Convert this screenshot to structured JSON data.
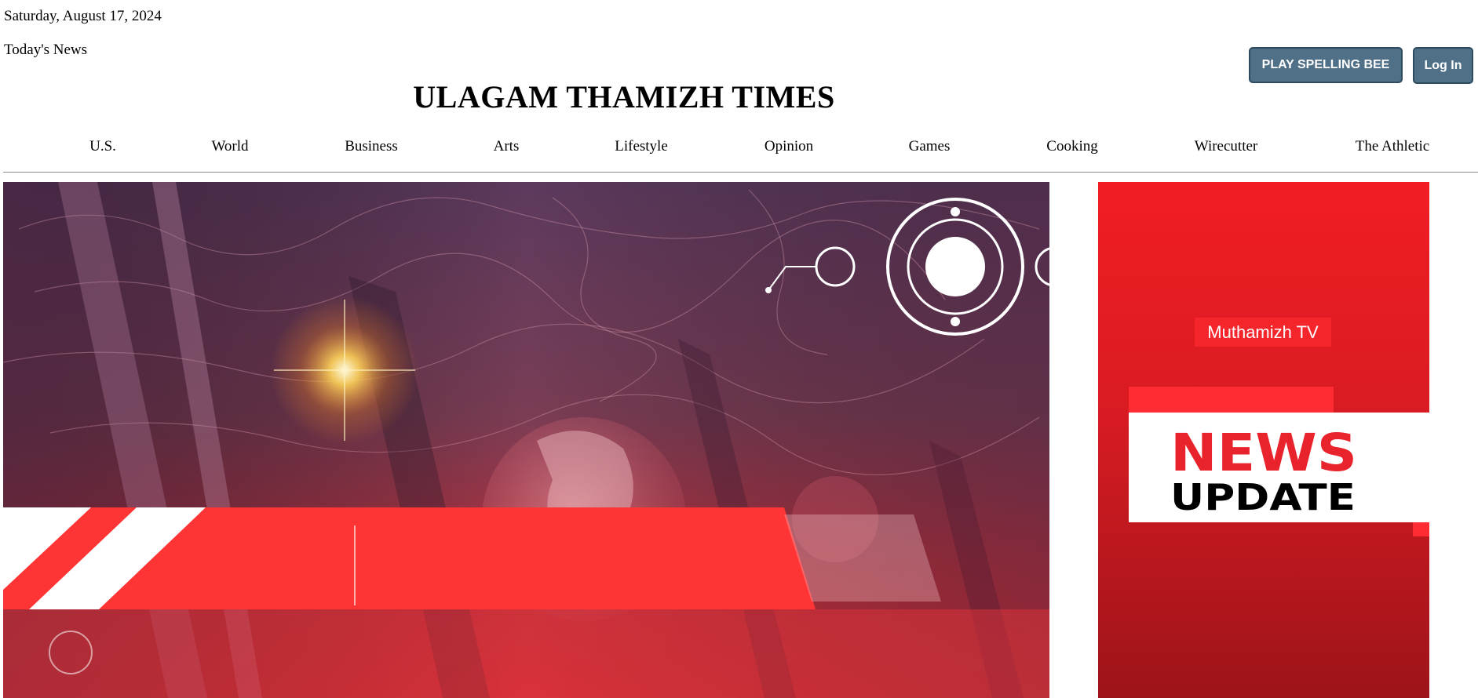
{
  "header": {
    "date": "Saturday, August 17, 2024",
    "todays_news": "Today's News",
    "title": "ULAGAM THAMIZH TIMES",
    "buttons": {
      "spelling_bee": "PLAY SPELLING BEE",
      "login": "Log In"
    }
  },
  "nav": {
    "items": [
      {
        "label": "U.S."
      },
      {
        "label": "World"
      },
      {
        "label": "Business"
      },
      {
        "label": "Arts"
      },
      {
        "label": "Lifestyle"
      },
      {
        "label": "Opinion"
      },
      {
        "label": "Games"
      },
      {
        "label": "Cooking"
      },
      {
        "label": "Wirecutter"
      },
      {
        "label": "The Athletic"
      }
    ]
  },
  "ad": {
    "channel": "Muthamizh TV",
    "headline_top": "NEWS",
    "headline_bottom": "UPDATE"
  },
  "colors": {
    "button_bg": "#507088",
    "news_red": "#e8232b",
    "hero_red": "#ff3434"
  }
}
